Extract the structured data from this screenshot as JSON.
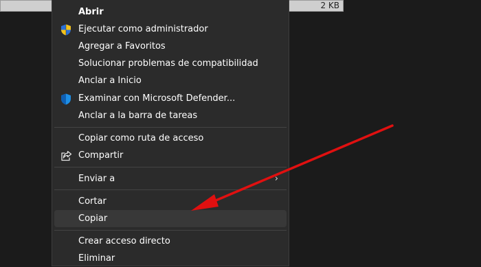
{
  "file_row": {
    "size": "2 KB"
  },
  "menu": {
    "items": [
      {
        "label": "Abrir",
        "icon": "",
        "bold": true
      },
      {
        "label": "Ejecutar como administrador",
        "icon": "uac-shield-icon"
      },
      {
        "label": "Agregar a Favoritos",
        "icon": ""
      },
      {
        "label": "Solucionar problemas de compatibilidad",
        "icon": ""
      },
      {
        "label": "Anclar a Inicio",
        "icon": ""
      },
      {
        "label": "Examinar con Microsoft Defender...",
        "icon": "defender-shield-icon"
      },
      {
        "label": "Anclar a la barra de tareas",
        "icon": ""
      },
      {
        "label": "Copiar como ruta de acceso",
        "icon": ""
      },
      {
        "label": "Compartir",
        "icon": "share-icon"
      },
      {
        "label": "Enviar a",
        "icon": "",
        "submenu": true,
        "arrow": "›"
      },
      {
        "label": "Cortar",
        "icon": ""
      },
      {
        "label": "Copiar",
        "icon": "",
        "hover": true
      },
      {
        "label": "Crear acceso directo",
        "icon": ""
      },
      {
        "label": "Eliminar",
        "icon": ""
      }
    ]
  },
  "annotation": {
    "arrow_color": "#e01010"
  }
}
